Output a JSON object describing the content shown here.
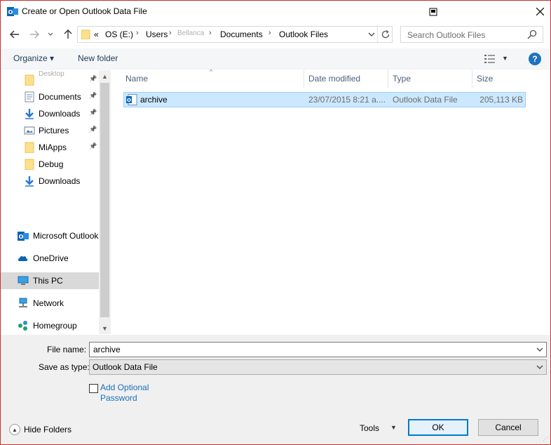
{
  "window": {
    "title": "Create or Open Outlook Data File"
  },
  "address": {
    "crumbs": [
      "«",
      "OS (E:)",
      "Users",
      "Bellanca",
      "Documents",
      "Outlook Files"
    ]
  },
  "search": {
    "placeholder": "Search Outlook Files"
  },
  "toolbar": {
    "organize_label": "Organize ▾",
    "new_folder_label": "New folder"
  },
  "navpane": {
    "items": [
      {
        "label": "Desktop",
        "pinned": true,
        "icon": "folder-icon"
      },
      {
        "label": "Documents",
        "pinned": true,
        "icon": "documents-icon"
      },
      {
        "label": "Downloads",
        "pinned": true,
        "icon": "downloads-icon"
      },
      {
        "label": "Pictures",
        "pinned": true,
        "icon": "pictures-icon"
      },
      {
        "label": "MiApps",
        "pinned": true,
        "icon": "folder-icon"
      },
      {
        "label": "Debug",
        "pinned": false,
        "icon": "folder-icon"
      },
      {
        "label": "Downloads",
        "pinned": false,
        "icon": "downloads-icon"
      }
    ],
    "roots": [
      {
        "label": "Microsoft Outlook",
        "icon": "outlook-icon"
      },
      {
        "label": "OneDrive",
        "icon": "onedrive-icon"
      },
      {
        "label": "This PC",
        "icon": "this-pc-icon",
        "selected": true
      },
      {
        "label": "Network",
        "icon": "network-icon"
      },
      {
        "label": "Homegroup",
        "icon": "homegroup-icon"
      }
    ]
  },
  "filelist": {
    "columns": [
      "Name",
      "Date modified",
      "Type",
      "Size"
    ],
    "rows": [
      {
        "name": "archive",
        "date": "23/07/2015 8:21 a....",
        "type": "Outlook Data File",
        "size": "205,113 KB"
      }
    ]
  },
  "form": {
    "file_name_label": "File name:",
    "file_name_value": "archive",
    "save_as_type_label": "Save as type:",
    "save_as_type_value": "Outlook Data File",
    "add_optional_password_line1": "Add Optional",
    "add_optional_password_line2": "Password"
  },
  "footer": {
    "hide_folders_label": "Hide Folders",
    "tools_label": "Tools",
    "ok_label": "OK",
    "cancel_label": "Cancel"
  },
  "colors": {
    "selection": "#cce8ff",
    "accent": "#0078d7",
    "link": "#1a6fba",
    "window_border": "#c9302c"
  }
}
